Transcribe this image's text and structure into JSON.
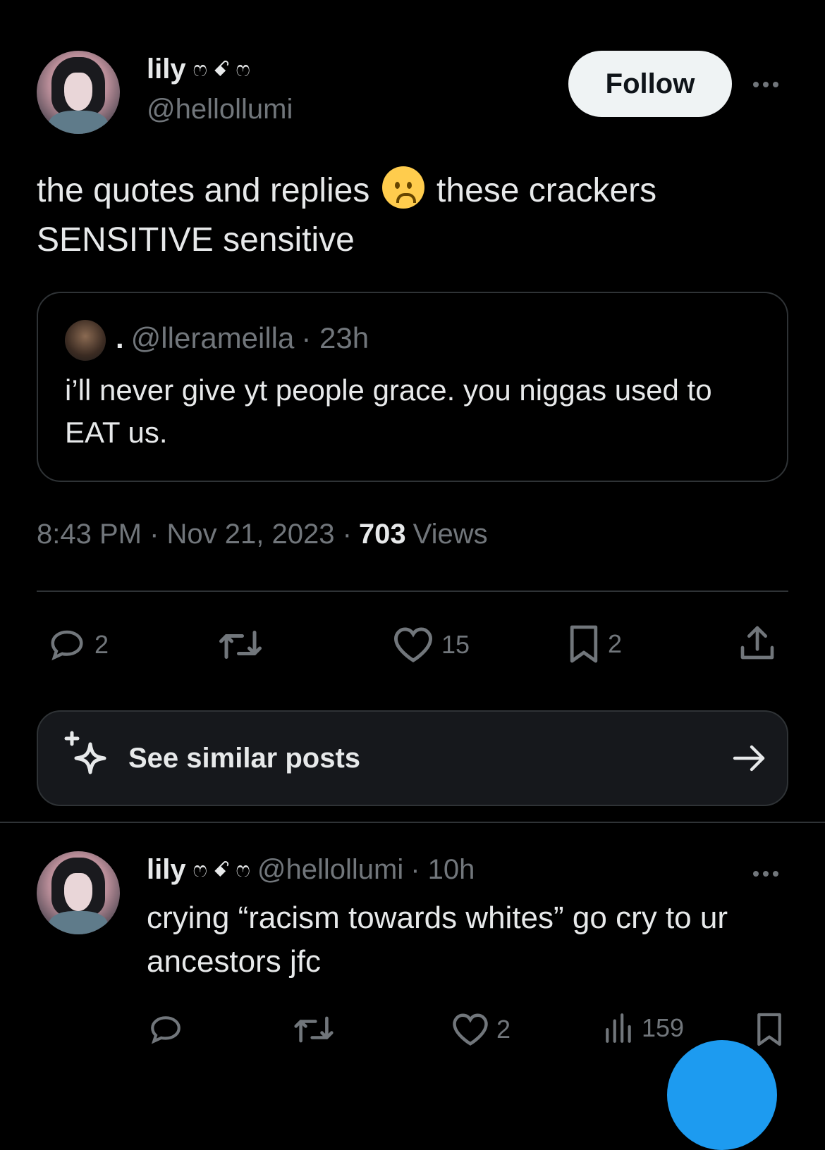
{
  "tweet": {
    "author_name": "lily",
    "author_decoration": "ෆ ꗃ ෆ",
    "author_handle": "@hellollumi",
    "follow_label": "Follow",
    "text_line1_before": "the quotes and replies",
    "text_line1_after": "these crackers",
    "text_line2": "SENSITIVE sensitive",
    "emoji": "frowning-face-emoji",
    "quote": {
      "display_name": ".",
      "handle": "@llerameilla",
      "time": "· 23h",
      "text": "i’ll never give yt people grace. you niggas used to EAT us."
    },
    "timestamp": "8:43 PM · Nov 21, 2023 ·",
    "views_count": "703",
    "views_label": "Views",
    "actions": {
      "replies": "2",
      "reposts": "",
      "likes": "15",
      "bookmarks": "2"
    }
  },
  "similar": {
    "label": "See similar posts"
  },
  "reply": {
    "author_name": "lily",
    "author_decoration": "ෆ ꗃ ෆ",
    "author_handle": "@hellollumi",
    "time": "· 10h",
    "text": "crying “racism towards whites” go cry to ur ancestors jfc",
    "actions": {
      "replies": "",
      "reposts": "",
      "likes": "2",
      "views": "159"
    }
  },
  "colors": {
    "background": "#000000",
    "text": "#e7e9ea",
    "muted": "#71767b",
    "border": "#2f3336",
    "accent": "#1d9bf0"
  }
}
